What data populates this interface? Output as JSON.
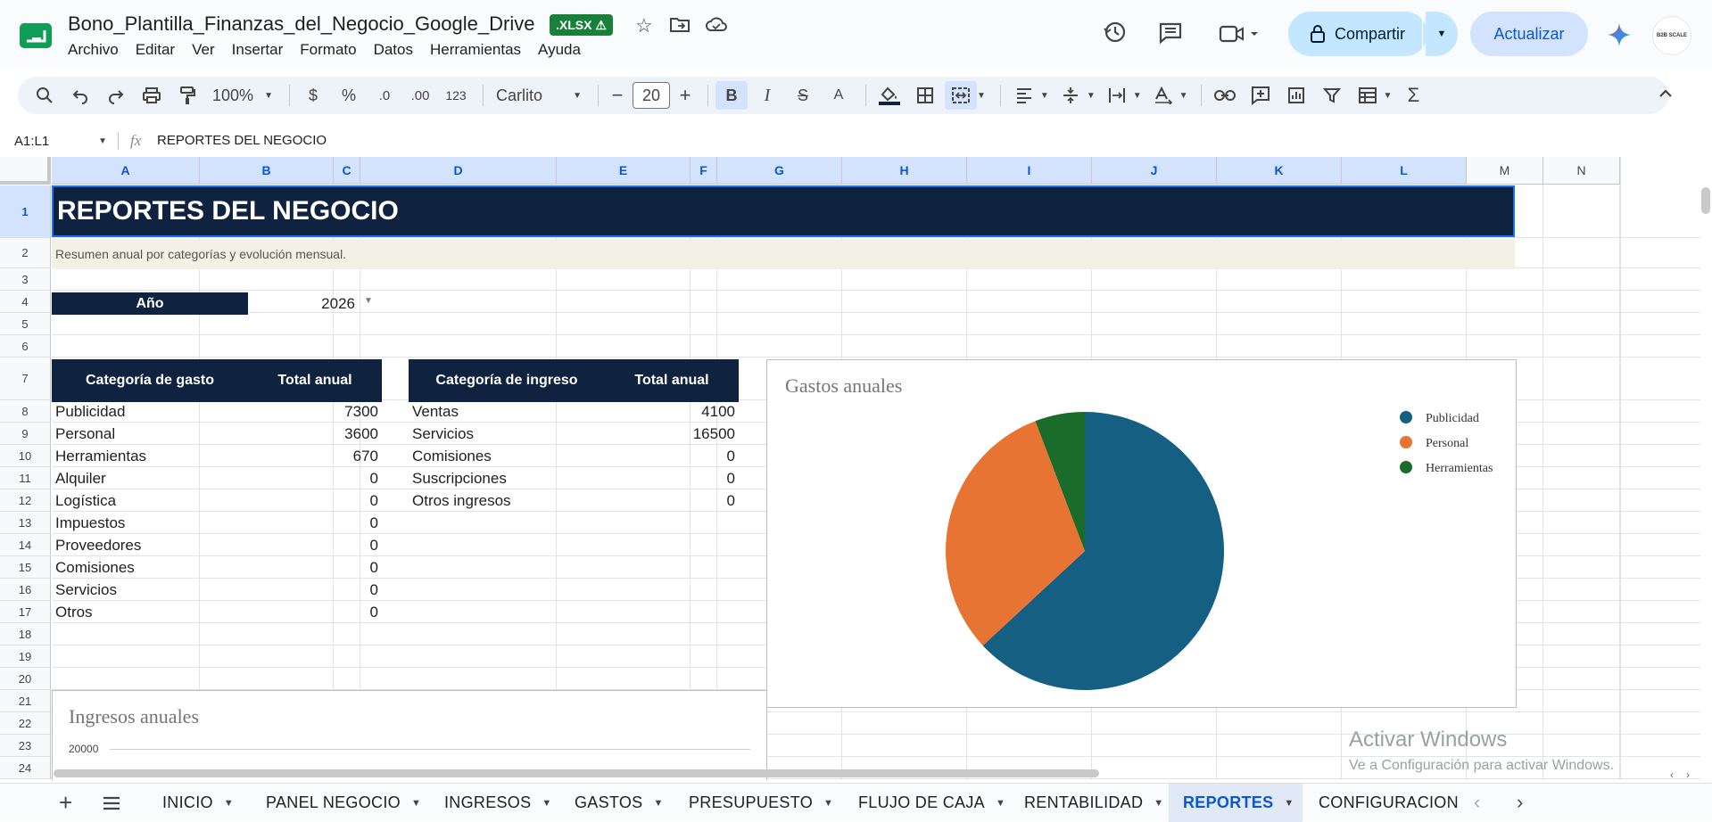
{
  "doc": {
    "title": "Bono_Plantilla_Finanzas_del_Negocio_Google_Drive",
    "badge": ".XLSX ⚠",
    "menus": [
      "Archivo",
      "Editar",
      "Ver",
      "Insertar",
      "Formato",
      "Datos",
      "Herramientas",
      "Ayuda"
    ],
    "share_label": "Compartir",
    "update_label": "Actualizar",
    "avatar_text": "B2B SCALE"
  },
  "toolbar": {
    "zoom": "100%",
    "currency": "$",
    "percent": "%",
    "dec_minus": ".0",
    "dec_plus": ".00",
    "format_123": "123",
    "font": "Carlito",
    "font_size": "20"
  },
  "formula": {
    "range": "A1:L1",
    "fx": "fx",
    "content": "REPORTES DEL NEGOCIO"
  },
  "columns": [
    "A",
    "B",
    "C",
    "D",
    "E",
    "F",
    "G",
    "H",
    "I",
    "J",
    "K",
    "L",
    "M",
    "N"
  ],
  "rows": [
    "1",
    "2",
    "3",
    "4",
    "5",
    "6",
    "7",
    "8",
    "9",
    "10",
    "11",
    "12",
    "13",
    "14",
    "15",
    "16",
    "17",
    "18",
    "19",
    "20",
    "21",
    "22",
    "23",
    "24"
  ],
  "sheet": {
    "title": "REPORTES DEL NEGOCIO",
    "subtitle": "Resumen anual por categorías y evolución mensual.",
    "year_label": "Año",
    "year_value": "2026",
    "expense_header": [
      "Categoría de gasto",
      "Total anual"
    ],
    "expenses": [
      {
        "cat": "Publicidad",
        "total": "7300"
      },
      {
        "cat": "Personal",
        "total": "3600"
      },
      {
        "cat": "Herramientas",
        "total": "670"
      },
      {
        "cat": "Alquiler",
        "total": "0"
      },
      {
        "cat": "Logística",
        "total": "0"
      },
      {
        "cat": "Impuestos",
        "total": "0"
      },
      {
        "cat": "Proveedores",
        "total": "0"
      },
      {
        "cat": "Comisiones",
        "total": "0"
      },
      {
        "cat": "Servicios",
        "total": "0"
      },
      {
        "cat": "Otros",
        "total": "0"
      }
    ],
    "income_header": [
      "Categoría de ingreso",
      "Total anual"
    ],
    "incomes": [
      {
        "cat": "Ventas",
        "total": "4100"
      },
      {
        "cat": "Servicios",
        "total": "16500"
      },
      {
        "cat": "Comisiones",
        "total": "0"
      },
      {
        "cat": "Suscripciones",
        "total": "0"
      },
      {
        "cat": "Otros ingresos",
        "total": "0"
      }
    ]
  },
  "chart_data": [
    {
      "type": "pie",
      "title": "Gastos anuales",
      "labels": [
        "Publicidad",
        "Personal",
        "Herramientas"
      ],
      "values": [
        7300,
        3600,
        670
      ],
      "colors": [
        "#155f83",
        "#e87434",
        "#1b6b2a"
      ],
      "legend": "right"
    },
    {
      "type": "bar",
      "title": "Ingresos anuales",
      "ytick_top": "20000"
    }
  ],
  "tabs": [
    "INICIO",
    "PANEL NEGOCIO",
    "INGRESOS",
    "GASTOS",
    "PRESUPUESTO",
    "FLUJO DE CAJA",
    "RENTABILIDAD",
    "REPORTES",
    "CONFIGURACION"
  ],
  "active_tab": "REPORTES",
  "watermark": {
    "line1": "Activar Windows",
    "line2": "Ve a Configuración para activar Windows."
  },
  "colors": {
    "header_navy": "#0f2340",
    "subtitle_bg": "#f3f0e6",
    "accent_blue": "#0b57d0",
    "badge_green": "#188038"
  }
}
